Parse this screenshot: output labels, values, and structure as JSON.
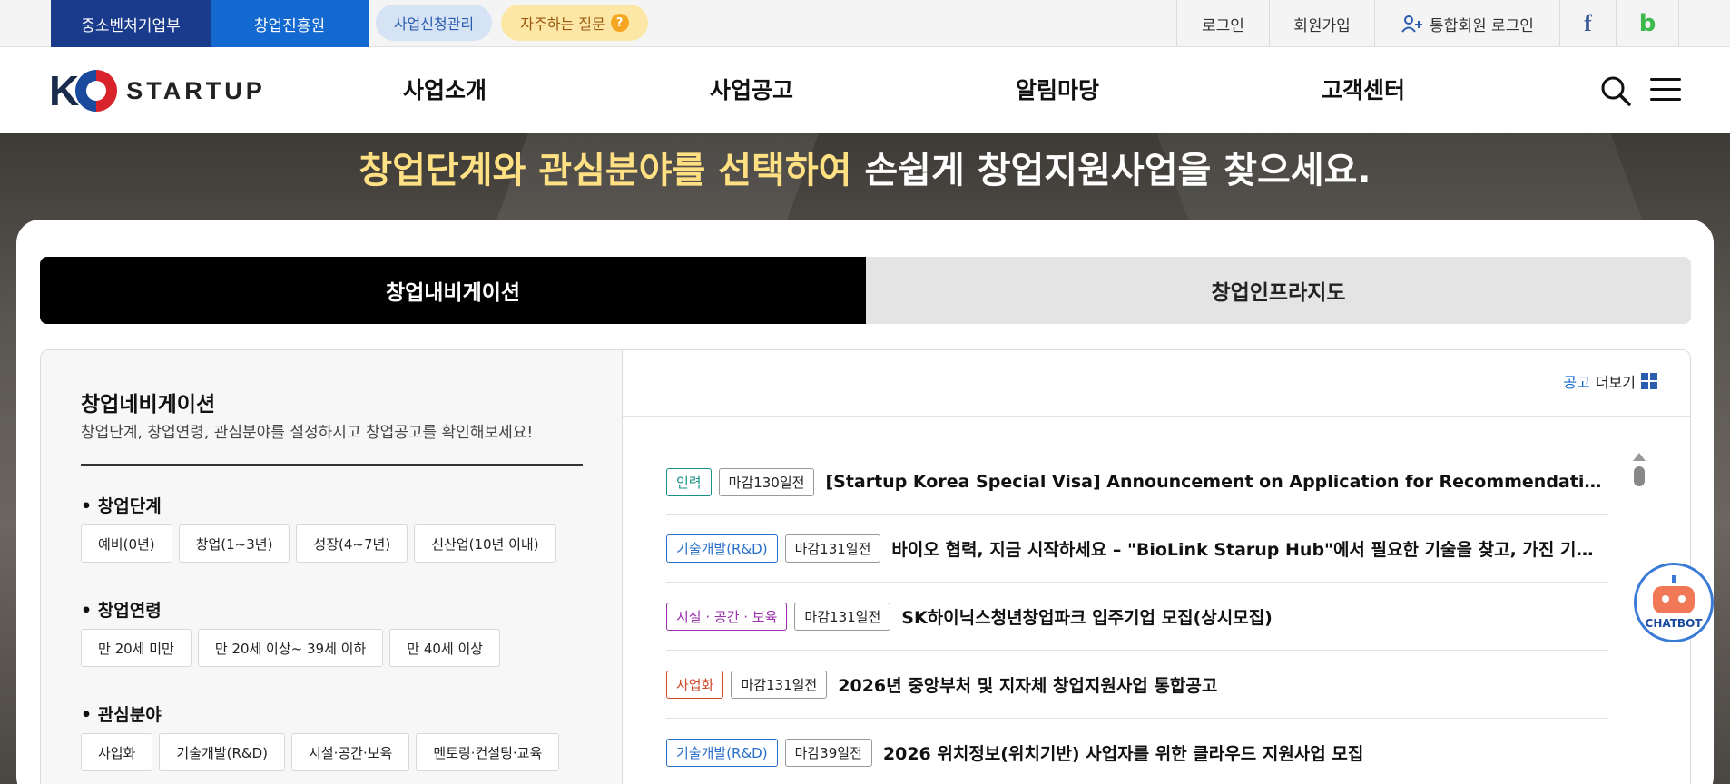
{
  "topbar": {
    "gov_label": "중소벤처기업부",
    "kised_label": "창업진흥원",
    "biz_apply_label": "사업신청관리",
    "faq_label": "자주하는 질문",
    "faq_icon": "?",
    "login_label": "로그인",
    "join_label": "회원가입",
    "unified_login_label": "통합회원 로그인",
    "facebook_glyph": "f",
    "blog_glyph": "b"
  },
  "header": {
    "logo_k": "K",
    "logo_text": "STARTUP",
    "nav": [
      "사업소개",
      "사업공고",
      "알림마당",
      "고객센터"
    ]
  },
  "hero": {
    "title_highlight": "창업단계와 관심분야를 선택하여",
    "title_rest": " 손쉽게 창업지원사업을 찾으세요."
  },
  "tabs": {
    "navigation": "창업내비게이션",
    "infra_map": "창업인프라지도"
  },
  "left_panel": {
    "title": "창업네비게이션",
    "description": "창업단계, 창업연령, 관심분야를 설정하시고 창업공고를 확인해보세요!",
    "sections": [
      {
        "label": "창업단계",
        "chips": [
          "예비(0년)",
          "창업(1~3년)",
          "성장(4~7년)",
          "신산업(10년 이내)"
        ]
      },
      {
        "label": "창업연령",
        "chips": [
          "만 20세 미만",
          "만 20세 이상~ 39세 이하",
          "만 40세 이상"
        ]
      },
      {
        "label": "관심분야",
        "chips": [
          "사업화",
          "기술개발(R&D)",
          "시설·공간·보육",
          "멘토링·컨설팅·교육"
        ]
      }
    ]
  },
  "right_panel": {
    "more_prefix": "공고",
    "more_label": "더보기",
    "announcements": [
      {
        "category": "인력",
        "color": "#1a8f86",
        "dday": "마감130일전",
        "title": "[Startup Korea Special Visa] Announcement on Application for Recommendations for the “Startup Korea” Special Visa"
      },
      {
        "category": "기술개발(R&D)",
        "color": "#2a6fc9",
        "dday": "마감131일전",
        "title": "바이오 협력, 지금 시작하세요 – \"BioLink Starup Hub\"에서 필요한 기술을 찾고, 가진 기술을 연결하세요"
      },
      {
        "category": "시설 · 공간 · 보육",
        "color": "#9b2fae",
        "dday": "마감131일전",
        "title": "SK하이닉스청년창업파크 입주기업 모집(상시모집)"
      },
      {
        "category": "사업화",
        "color": "#d0482a",
        "dday": "마감131일전",
        "title": "2026년 중앙부처 및 지자체 창업지원사업 통합공고"
      },
      {
        "category": "기술개발(R&D)",
        "color": "#2a6fc9",
        "dday": "마감39일전",
        "title": "2026 위치정보(위치기반) 사업자를 위한 클라우드 지원사업 모집"
      }
    ]
  },
  "chatbot": {
    "label": "CHATBOT"
  }
}
